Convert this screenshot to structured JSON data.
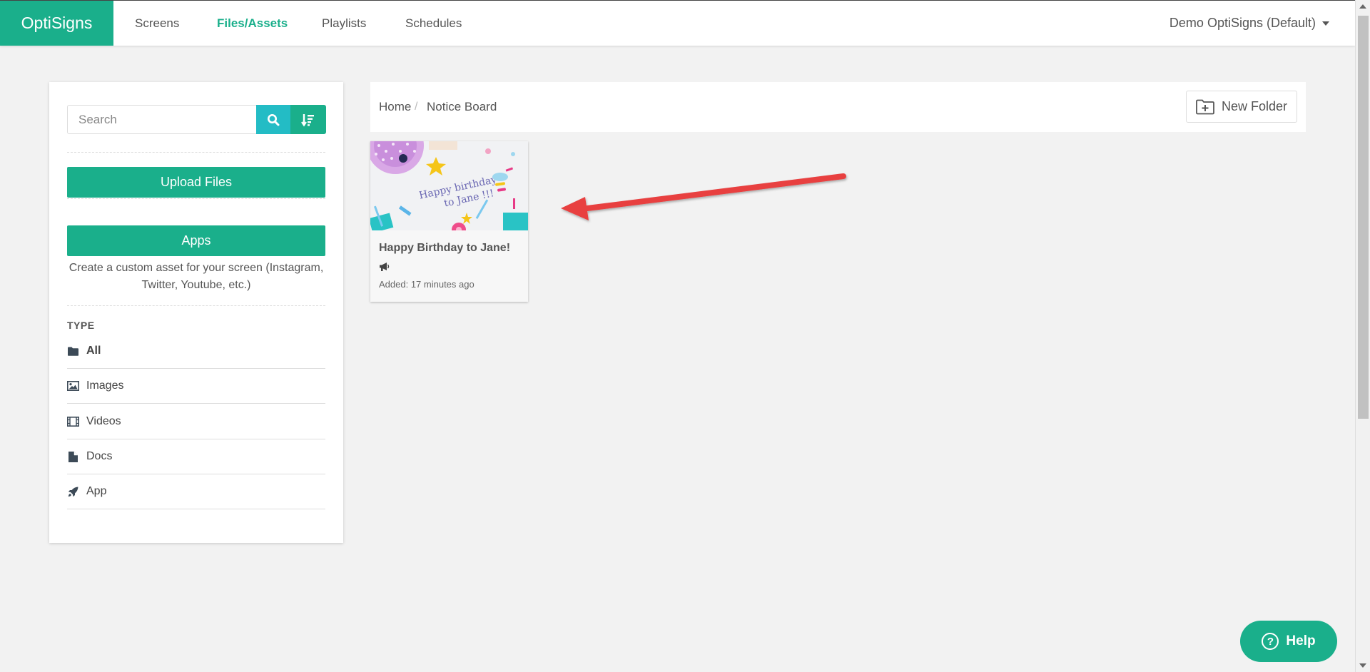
{
  "colors": {
    "brand": "#1aaf8b",
    "search_button": "#23bcc5",
    "arrow": "#e84040"
  },
  "nav": {
    "brand": "OptiSigns",
    "items": [
      {
        "label": "Screens",
        "active": false
      },
      {
        "label": "Files/Assets",
        "active": true
      },
      {
        "label": "Playlists",
        "active": false
      },
      {
        "label": "Schedules",
        "active": false
      }
    ],
    "account": "Demo OptiSigns (Default)"
  },
  "sidebar": {
    "search_placeholder": "Search",
    "upload_label": "Upload Files",
    "apps_label": "Apps",
    "apps_description": "Create a custom asset for your screen (Instagram, Twitter, Youtube, etc.)",
    "type_heading": "TYPE",
    "types": [
      {
        "label": "All",
        "icon": "folder-icon",
        "active": true
      },
      {
        "label": "Images",
        "icon": "image-icon",
        "active": false
      },
      {
        "label": "Videos",
        "icon": "film-icon",
        "active": false
      },
      {
        "label": "Docs",
        "icon": "file-icon",
        "active": false
      },
      {
        "label": "App",
        "icon": "rocket-icon",
        "active": false
      }
    ]
  },
  "breadcrumb": {
    "home": "Home",
    "separator": "/",
    "current": "Notice Board"
  },
  "new_folder_label": "New Folder",
  "asset": {
    "title": "Happy Birthday to Jane!",
    "type_icon": "megaphone-icon",
    "added": "Added: 17 minutes ago",
    "thumbnail_text_line1": "Happy birthday",
    "thumbnail_text_line2": "to Jane !!!"
  },
  "help_label": "Help"
}
